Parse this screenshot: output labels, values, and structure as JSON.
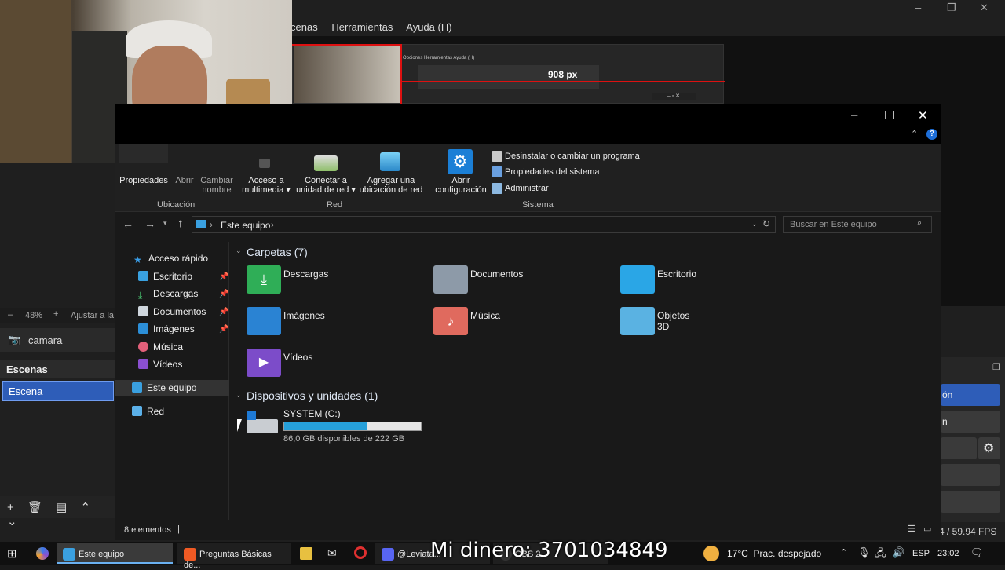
{
  "obs": {
    "menu": [
      "cenas",
      "Herramientas",
      "Ayuda (H)"
    ],
    "window_controls": [
      "–",
      "❐",
      "✕"
    ],
    "nested_menu": "Opciones  Herramientas  Ayuda (H)",
    "measure_label": "908 px",
    "zoom": "48%",
    "zoom_fit": "Ajustar a la",
    "source": "camara",
    "scenes_title": "Escenas",
    "scene_item": "Escena",
    "right_buttons": [
      "ón",
      "n"
    ],
    "fps": "4 / 59.94 FPS"
  },
  "explorer": {
    "window_controls": [
      "–",
      "☐",
      "✕"
    ],
    "ribbon": {
      "ubicacion": {
        "group_label": "Ubicación",
        "buttons": [
          "Propiedades",
          "Abrir",
          "Cambiar\nnombre"
        ]
      },
      "red": {
        "group_label": "Red",
        "buttons": [
          "Acceso a\nmultimedia ▾",
          "Conectar a\nunidad de red ▾",
          "Agregar una\nubicación de red"
        ]
      },
      "sistema": {
        "group_label": "Sistema",
        "open_settings": "Abrir\nconfiguración",
        "links": [
          "Desinstalar o cambiar un programa",
          "Propiedades del sistema",
          "Administrar"
        ]
      }
    },
    "address": "Este equipo",
    "search_placeholder": "Buscar en Este equipo",
    "nav": {
      "quick_access": "Acceso rápido",
      "items": [
        "Escritorio",
        "Descargas",
        "Documentos",
        "Imágenes",
        "Música",
        "Vídeos"
      ],
      "this_pc": "Este equipo",
      "network": "Red"
    },
    "folders_title": "Carpetas (7)",
    "folders": [
      "Descargas",
      "Documentos",
      "Escritorio",
      "Imágenes",
      "Música",
      "Objetos 3D",
      "Vídeos"
    ],
    "devices_title": "Dispositivos y unidades (1)",
    "drive": {
      "name": "SYSTEM (C:)",
      "free_text": "86,0 GB disponibles de 222 GB",
      "used_fraction": 0.61
    },
    "status": "8 elementos"
  },
  "taskbar": {
    "apps": [
      "Este equipo",
      "Preguntas Básicas de...",
      "@Leviata..."
    ],
    "obs_partial": "OBS 2",
    "weather": "17°C  Prac. despejado",
    "lang": "ESP",
    "time": "23:02"
  },
  "overlay": "Mi dinero: 3701034849",
  "colors": {
    "accent": "#26a0da",
    "scene_selected": "#2e5db8",
    "measure_line": "#dd1111"
  }
}
